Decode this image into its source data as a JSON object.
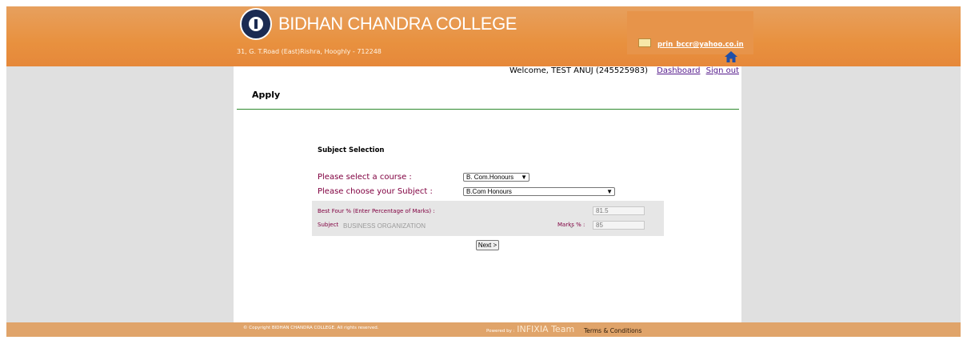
{
  "header": {
    "college_name": "BIDHAN CHANDRA COLLEGE",
    "address": "31, G. T.Road (East)Rishra, Hooghly - 712248",
    "email": "prin_bccr@yahoo.co.in",
    "logo_icon": "college-seal-icon",
    "mail_icon": "envelope-icon",
    "home_icon": "home-icon",
    "accent_color": "#e8913f"
  },
  "user_bar": {
    "welcome": "Welcome, TEST ANUJ (245525983)",
    "dashboard_label": "Dashboard",
    "signout_label": "Sign out"
  },
  "page": {
    "title": "Apply"
  },
  "form": {
    "section_title": "Subject Selection",
    "course_label": "Please select a course :",
    "course_selected": "B. Com.Honours",
    "subject_label": "Please choose your Subject :",
    "subject_selected": "B.Com Honours",
    "best_four_label": "Best Four % (Enter Percentage of Marks) :",
    "best_four_value": "81.5",
    "subject_row_label": "Subject",
    "subject_row_value": "BUSINESS ORGANIZATION",
    "marks_label": "Marks % :",
    "marks_value": "85",
    "next_label": "Next >"
  },
  "footer": {
    "copyright": "© Copyright BIDHAN CHANDRA COLLEGE. All rights reserved.",
    "powered_by": "Powered by :",
    "team": "INFIXIA Team",
    "terms": "Terms & Conditions"
  }
}
